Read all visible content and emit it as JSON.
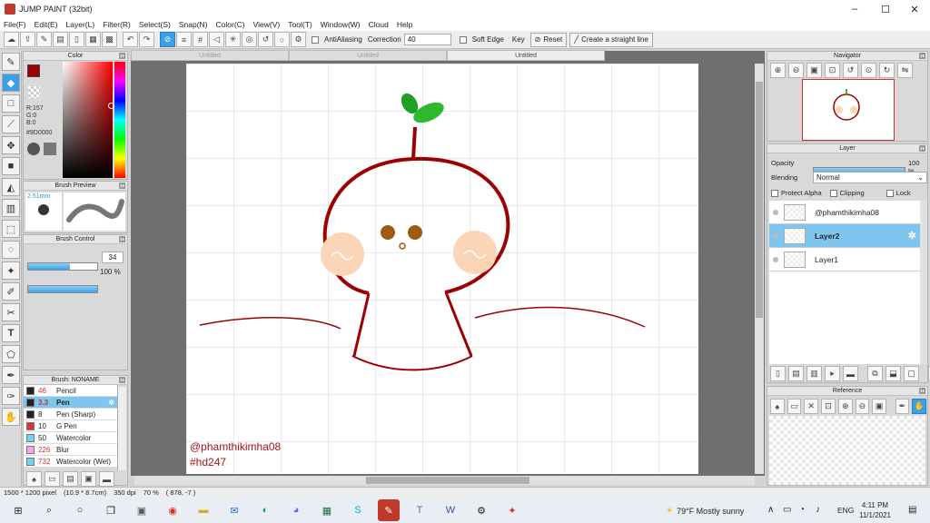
{
  "window": {
    "title": "JUMP PAINT (32bit)",
    "controls": [
      "–",
      "☐",
      "✕"
    ]
  },
  "menu": [
    "File(F)",
    "Edit(E)",
    "Layer(L)",
    "Filter(R)",
    "Select(S)",
    "Snap(N)",
    "Color(C)",
    "View(V)",
    "Tool(T)",
    "Window(W)",
    "Cloud",
    "Help"
  ],
  "toolbar": {
    "antialiasing_label": "AntiAliasing",
    "correction_label": "Correction",
    "correction_value": "40",
    "soft_edge_label": "Soft Edge",
    "key_label": "Key",
    "reset_label": "Reset",
    "straight_line_label": "Create a straight line"
  },
  "tabs": [
    {
      "label": "Untitled",
      "active": false
    },
    {
      "label": "Untitled",
      "active": false
    },
    {
      "label": "Untitled",
      "active": true
    }
  ],
  "color_panel": {
    "title": "Color",
    "r": "R:157",
    "g": "G:0",
    "b": "B:0",
    "hex": "#9D0000",
    "current_color": "#9d0000"
  },
  "brush_preview": {
    "title": "Brush Preview",
    "size": "2.51mm"
  },
  "brush_control": {
    "title": "Brush Control",
    "size_value": "34",
    "opacity_value": "100 %",
    "size_fraction": 0.6,
    "opacity_fraction": 1.0
  },
  "brush_list": {
    "title": "Brush: NONAME",
    "items": [
      {
        "size": "46",
        "name": "Pencil",
        "color": "#222222",
        "size_color": "#d03030"
      },
      {
        "size": "3.3",
        "name": "Pen",
        "color": "#222222",
        "size_color": "#d03030",
        "selected": true
      },
      {
        "size": "8",
        "name": "Pen (Sharp)",
        "color": "#222222",
        "size_color": "#222222"
      },
      {
        "size": "10",
        "name": "G Pen",
        "color": "#e03030",
        "size_color": "#222222"
      },
      {
        "size": "50",
        "name": "Watercolor",
        "color": "#6fd3f5",
        "size_color": "#222222"
      },
      {
        "size": "226",
        "name": "Blur",
        "color": "#f7a8e8",
        "size_color": "#d03030"
      },
      {
        "size": "732",
        "name": "Watercolor (Wet)",
        "color": "#6fd3f5",
        "size_color": "#d03030"
      }
    ]
  },
  "navigator": {
    "title": "Navigator"
  },
  "layer_panel": {
    "title": "Layer",
    "opacity_label": "Opacity",
    "opacity_value": "100 %",
    "opacity_fraction": 1.0,
    "blending_label": "Blending",
    "blending_value": "Normal",
    "protect_alpha_label": "Protect Alpha",
    "clipping_label": "Clipping",
    "lock_label": "Lock",
    "layers": [
      {
        "name": "@phamthikimha08",
        "selected": false
      },
      {
        "name": "Layer2",
        "selected": true
      },
      {
        "name": "Layer1",
        "selected": false
      }
    ]
  },
  "reference": {
    "title": "Reference"
  },
  "canvas": {
    "watermark_line1": "@phamthikimha08",
    "watermark_line2": "#hd247"
  },
  "status": {
    "size": "1500 * 1200 pixel",
    "dims": "(10.9 * 8.7cm)",
    "dpi": "350 dpi",
    "zoom": "70 %",
    "coords": "( 878, -7 )"
  },
  "taskbar": {
    "weather": "79°F  Mostly sunny",
    "lang": "ENG",
    "time": "4:11 PM",
    "date": "11/1/2021"
  }
}
